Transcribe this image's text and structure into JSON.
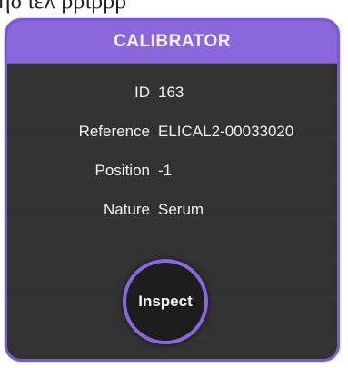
{
  "background": {
    "top_strip_text": "ηδ  ιελ  ρριρρρ"
  },
  "dialog": {
    "title": "CALIBRATOR",
    "fields": [
      {
        "label": "ID",
        "value": "163"
      },
      {
        "label": "Reference",
        "value": "ELICAL2-00033020"
      },
      {
        "label": "Position",
        "value": "-1"
      },
      {
        "label": "Nature",
        "value": "Serum"
      }
    ],
    "inspect_label": "Inspect"
  },
  "colors": {
    "accent": "#8a68dc",
    "panel": "#3a3a3a",
    "button": "#1d1d1d",
    "text": "#f0f0f0"
  }
}
